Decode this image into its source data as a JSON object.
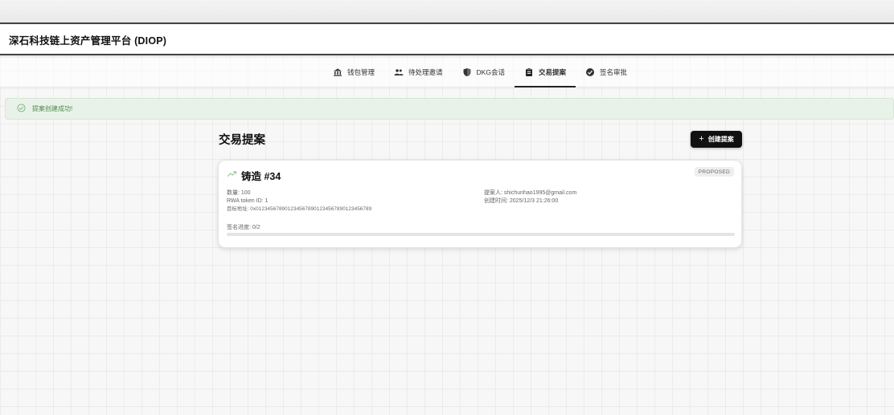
{
  "app": {
    "title": "深石科技链上资产管理平台 (DIOP)"
  },
  "nav": {
    "tabs": [
      {
        "label": "钱包管理",
        "icon": "bank-icon"
      },
      {
        "label": "待处理邀请",
        "icon": "group-icon"
      },
      {
        "label": "DKG会话",
        "icon": "shield-icon"
      },
      {
        "label": "交易提案",
        "icon": "clipboard-icon",
        "active": true
      },
      {
        "label": "签名审批",
        "icon": "check-circle-icon"
      }
    ]
  },
  "alert": {
    "message": "提案创建成功!",
    "color": "#4e8a4c"
  },
  "page": {
    "title": "交易提案",
    "create_label": "创建提案"
  },
  "proposal": {
    "title": "铸造 #34",
    "status": "PROPOSED",
    "amount": "数量: 100",
    "token_id": "RWA token ID: 1",
    "target": "目标地址: 0x0123456789012345678901234567890123456789",
    "proposer": "提案人: shichunhao1995@gmail.com",
    "created": "创建时间: 2025/12/3 21:26:00",
    "progress_label": "签名进度: 0/2",
    "progress_fraction": 0
  }
}
